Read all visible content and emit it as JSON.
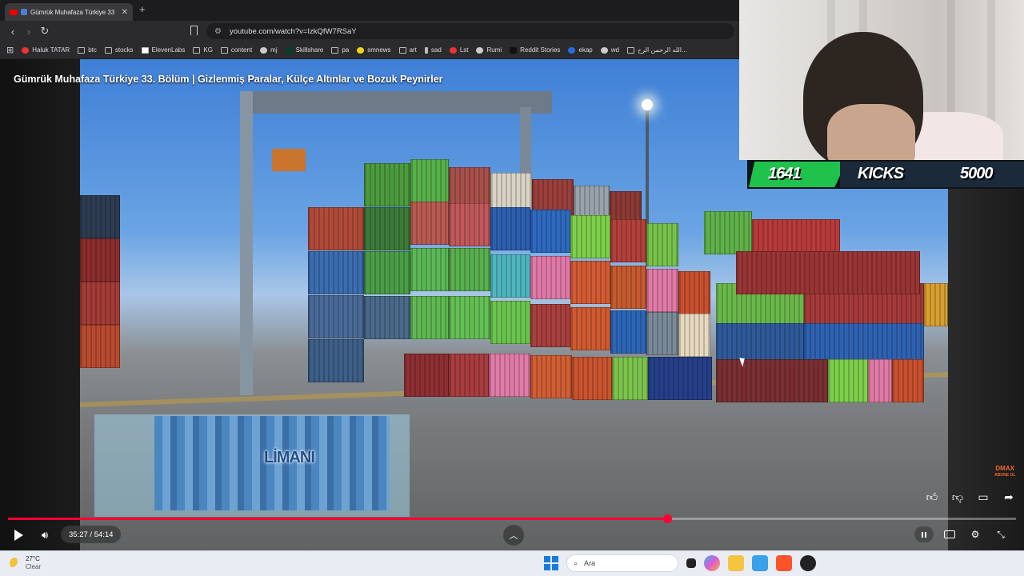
{
  "browser": {
    "tab_title": "Gümrük Muhafaza Türkiye 33",
    "new_tab": "+",
    "url": "youtube.com/watch?v=IzkQfW7RSaY"
  },
  "bookmarks": [
    {
      "label": "Haluk TATAR",
      "icon": "red-dot-icon"
    },
    {
      "label": "btc",
      "icon": "folder-icon"
    },
    {
      "label": "stocks",
      "icon": "folder-icon"
    },
    {
      "label": "ElevenLabs",
      "icon": "elevenlabs-icon"
    },
    {
      "label": "KG",
      "icon": "folder-icon"
    },
    {
      "label": "content",
      "icon": "folder-icon"
    },
    {
      "label": "mj",
      "icon": "github-icon"
    },
    {
      "label": "Skillshare",
      "icon": "skillshare-icon"
    },
    {
      "label": "pa",
      "icon": "folder-icon"
    },
    {
      "label": "smnews",
      "icon": "smiley-icon"
    },
    {
      "label": "art",
      "icon": "folder-icon"
    },
    {
      "label": "sad",
      "icon": "pen-icon"
    },
    {
      "label": "Lst",
      "icon": "s-logo-icon"
    },
    {
      "label": "Rumi",
      "icon": "globe-icon"
    },
    {
      "label": "Reddit Stories",
      "icon": "d-logo-icon"
    },
    {
      "label": "ekap",
      "icon": "bird-icon"
    },
    {
      "label": "wd",
      "icon": "globe-icon"
    },
    {
      "label": "الله الرحمن الرح...",
      "icon": "page-icon"
    }
  ],
  "video": {
    "title": "Gümrük Muhafaza Türkiye 33. Bölüm | Gizlenmiş Paralar, Külçe Altınlar ve Bozuk Peynirler",
    "inset_label": "LİMANI",
    "channel_bug": "DMAX",
    "channel_bug_sub": "ABONE OL",
    "time": "35:27 / 54:14",
    "progress": 0.654
  },
  "overlay": {
    "current": "1641",
    "label": "KICKS",
    "goal": "5000"
  },
  "taskbar": {
    "temp": "27°C",
    "condition": "Clear",
    "search_placeholder": "Ara"
  },
  "colors": {
    "progress": "#ff0033",
    "goal_green": "#1fc24a"
  }
}
